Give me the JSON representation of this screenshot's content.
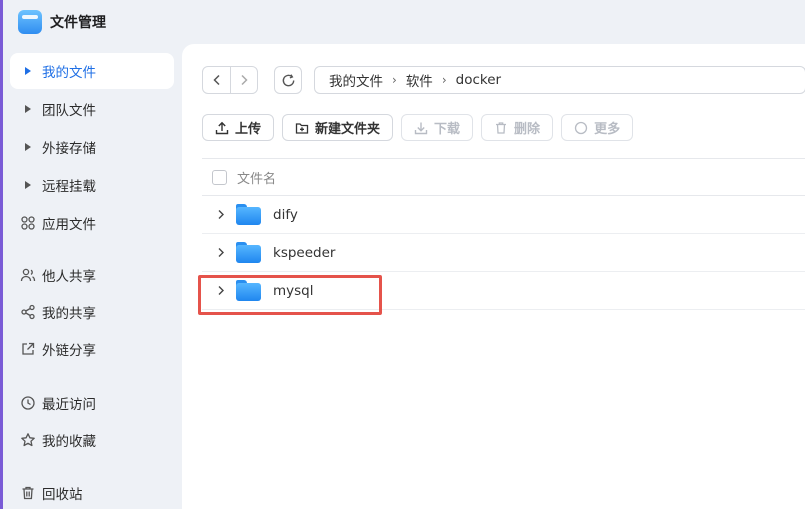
{
  "app": {
    "title": "文件管理",
    "accent": "#1f6fe5",
    "highlight_color": "#e5534b"
  },
  "sidebar": {
    "items": [
      {
        "label": "我的文件",
        "icon": "caret-right-icon",
        "active": true
      },
      {
        "label": "团队文件",
        "icon": "caret-right-icon"
      },
      {
        "label": "外接存储",
        "icon": "caret-right-icon"
      },
      {
        "label": "远程挂载",
        "icon": "caret-right-icon"
      },
      {
        "label": "应用文件",
        "icon": "apps-icon"
      },
      {
        "label": "他人共享",
        "icon": "users-icon"
      },
      {
        "label": "我的共享",
        "icon": "share-icon"
      },
      {
        "label": "外链分享",
        "icon": "external-link-icon"
      },
      {
        "label": "最近访问",
        "icon": "clock-icon"
      },
      {
        "label": "我的收藏",
        "icon": "star-icon"
      },
      {
        "label": "回收站",
        "icon": "trash-icon"
      }
    ]
  },
  "breadcrumb": [
    "我的文件",
    "软件",
    "docker"
  ],
  "toolbar": {
    "upload": "上传",
    "new_folder": "新建文件夹",
    "download": "下载",
    "delete": "删除",
    "more": "更多"
  },
  "table": {
    "header": "文件名",
    "rows": [
      {
        "name": "dify"
      },
      {
        "name": "kspeeder"
      },
      {
        "name": "mysql"
      }
    ]
  }
}
